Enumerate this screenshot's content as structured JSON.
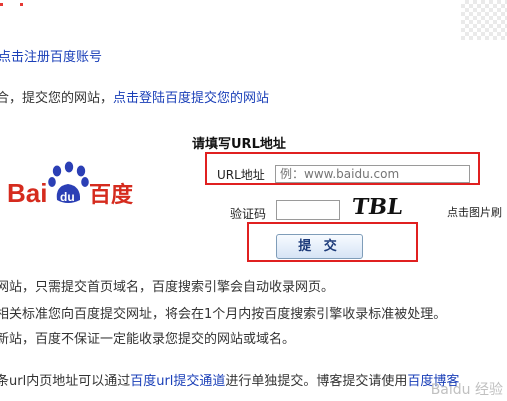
{
  "header": {
    "register_link": "点击注册百度账号",
    "intro_prefix": "合，提交您的网站，",
    "intro_link": "点击登陆百度提交您的网站"
  },
  "form": {
    "title": "请填写URL地址",
    "url_label": "URL地址",
    "url_placeholder": "例：www.baidu.com",
    "captcha_label": "验证码",
    "captcha_text": "TBL",
    "refresh_hint": "点击图片刷",
    "submit_label": "提 交"
  },
  "logo": {
    "text_bai": "Bai",
    "text_du": "du",
    "text_cn": "百度",
    "brand_color": "#d52b1e",
    "paw_color": "#2b3fb5"
  },
  "notes": [
    "网站，只需提交首页域名，百度搜索引擎会自动收录网页。",
    "相关标准您向百度提交网址，将会在1个月内按百度搜索引擎收录标准被处理。",
    "新站，百度不保证一定能收录您提交的网站或域名。"
  ],
  "footer": {
    "prefix": "条url内页地址可以通过",
    "link1": "百度url提交通道",
    "mid": "进行单独提交。博客提交请使用",
    "link2": "百度博客"
  },
  "watermark": "Baidu 经验"
}
